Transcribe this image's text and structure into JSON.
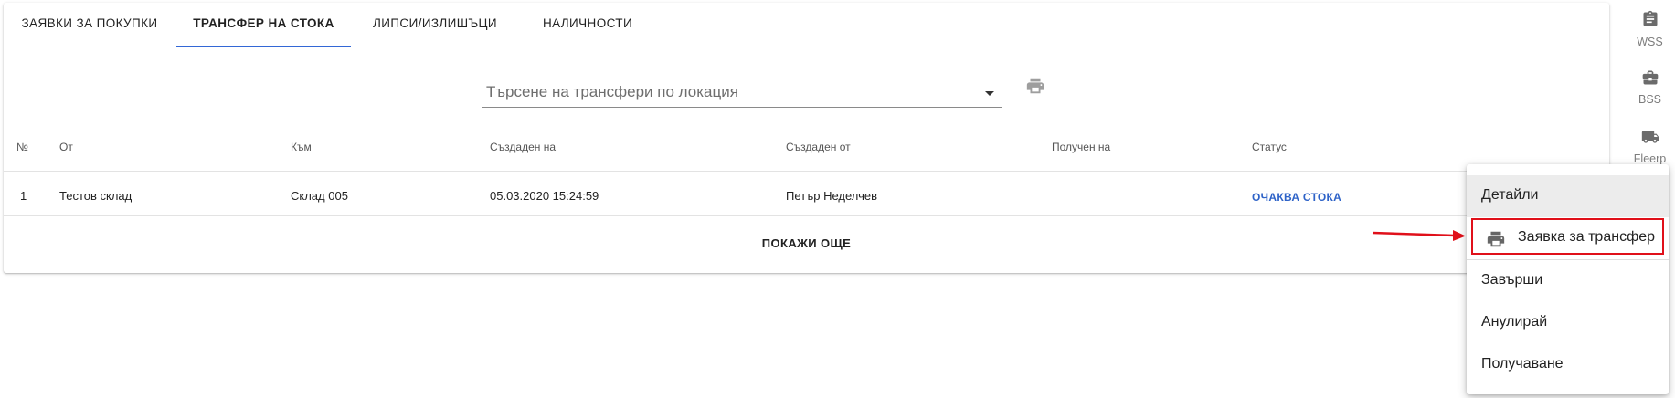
{
  "tabs": [
    {
      "label": "ЗАЯВКИ ЗА ПОКУПКИ",
      "active": false
    },
    {
      "label": "ТРАНСФЕР НА СТОКА",
      "active": true
    },
    {
      "label": "ЛИПСИ/ИЗЛИШЪЦИ",
      "active": false
    },
    {
      "label": "НАЛИЧНОСТИ",
      "active": false
    }
  ],
  "search": {
    "placeholder": "Търсене на трансфери по локация"
  },
  "table": {
    "headers": [
      "№",
      "От",
      "Към",
      "Създаден на",
      "Създаден от",
      "Получен на",
      "Статус"
    ],
    "rows": [
      {
        "no": "1",
        "from": "Тестов склад",
        "to": "Склад 005",
        "created_at": "05.03.2020 15:24:59",
        "created_by": "Петър Неделчев",
        "received_at": "",
        "status": "ОЧАКВА СТОКА"
      }
    ],
    "show_more": "ПОКАЖИ ОЩЕ"
  },
  "side_nav": [
    {
      "label": "WSS",
      "icon": "clipboard-icon"
    },
    {
      "label": "BSS",
      "icon": "briefcase-icon"
    },
    {
      "label": "Fleerp",
      "icon": "truck-icon"
    }
  ],
  "context_menu": {
    "items": [
      {
        "label": "Детайли"
      },
      {
        "label": "Заявка за трансфер",
        "icon": "printer-icon"
      },
      {
        "label": "Завърши"
      },
      {
        "label": "Анулирай"
      },
      {
        "label": "Получаване"
      }
    ]
  },
  "colors": {
    "accent": "#3367d6",
    "status": "#2e63c8",
    "annotation": "#e0101a"
  }
}
